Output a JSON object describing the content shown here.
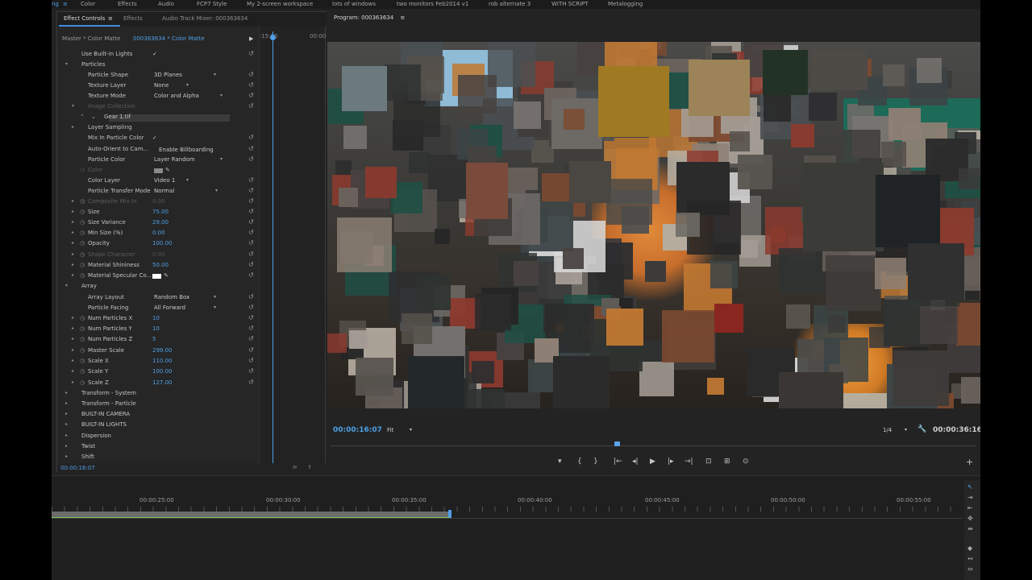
{
  "workspaces": [
    "ng",
    "≡",
    "Color",
    "Effects",
    "Audio",
    "FCP7 Style",
    "My 2-screen workspace",
    "lots of windows",
    "two monitors Feb2014 v1",
    "rob alternate 3",
    "WITH SCRIPT",
    "Metalogging"
  ],
  "panel_tabs": {
    "effect_controls": "Effect Controls",
    "menu": "≡",
    "effects": "Effects",
    "audio_mixer": "Audio Track Mixer: 000363634"
  },
  "clip": {
    "master": "Master * Color Matte",
    "sequence_clip": "000363634 * Color Matte",
    "play": "▶",
    "ruler_start": ":15:00",
    "ruler_end": "00:00"
  },
  "rows": [
    {
      "t": "",
      "s": "",
      "label": "Use Built-in Lights",
      "value": "✓"
    },
    {
      "t": "▾",
      "s": "",
      "label": "Particles",
      "value": ""
    },
    {
      "t": "",
      "s": "",
      "label": "Particle Shape",
      "value": "3D Planes",
      "dd": "▾"
    },
    {
      "t": "",
      "s": "",
      "label": "Texture Layer",
      "value": "None",
      "dd": "▾"
    },
    {
      "t": "",
      "s": "",
      "label": "Texture Mode",
      "value": "Color and Alpha",
      "dd": "▾"
    },
    {
      "t": "▾",
      "s": "",
      "label": "Image Collection",
      "value": ""
    },
    {
      "t": "",
      "s": "",
      "label": "Gear 1.tif",
      "value": ""
    },
    {
      "t": "▸",
      "s": "",
      "label": "Layer Sampling",
      "value": ""
    },
    {
      "t": "",
      "s": "",
      "label": "Mix In Particle Color",
      "value": "✓"
    },
    {
      "t": "",
      "s": "",
      "label": "Auto-Orient to Cam...",
      "value": "Enable Billboarding"
    },
    {
      "t": "",
      "s": "",
      "label": "Particle Color",
      "value": "Layer Random",
      "dd": "▾"
    },
    {
      "t": "",
      "s": "◷",
      "label": "Color",
      "value": ""
    },
    {
      "t": "",
      "s": "",
      "label": "Color Layer",
      "value": "Video 1",
      "dd": "▾"
    },
    {
      "t": "",
      "s": "",
      "label": "Particle Transfer Mode",
      "value": "Normal",
      "dd": "▾"
    },
    {
      "t": "▸",
      "s": "◷",
      "label": "Composite Mix In",
      "value": "0.00"
    },
    {
      "t": "▸",
      "s": "◷",
      "label": "Size",
      "value": "75.00"
    },
    {
      "t": "▸",
      "s": "◷",
      "label": "Size Variance",
      "value": "29.00"
    },
    {
      "t": "▸",
      "s": "◷",
      "label": "Min Size (%)",
      "value": "0.00"
    },
    {
      "t": "▸",
      "s": "◷",
      "label": "Opacity",
      "value": "100.00"
    },
    {
      "t": "▸",
      "s": "◷",
      "label": "Shape Character",
      "value": "0.00"
    },
    {
      "t": "▸",
      "s": "◷",
      "label": "Material Shininess",
      "value": "50.00"
    },
    {
      "t": "▸",
      "s": "◷",
      "label": "Material Specular Co...",
      "value": ""
    },
    {
      "t": "▾",
      "s": "",
      "label": "Array",
      "value": ""
    },
    {
      "t": "",
      "s": "",
      "label": "Array Layout",
      "value": "Random Box",
      "dd": "▾"
    },
    {
      "t": "",
      "s": "",
      "label": "Particle Facing",
      "value": "All Forward",
      "dd": "▾"
    },
    {
      "t": "▸",
      "s": "◷",
      "label": "Num Particles X",
      "value": "10"
    },
    {
      "t": "▸",
      "s": "◷",
      "label": "Num Particles Y",
      "value": "10"
    },
    {
      "t": "▸",
      "s": "◷",
      "label": "Num Particles Z",
      "value": "5"
    },
    {
      "t": "▸",
      "s": "◷",
      "label": "Master Scale",
      "value": "299.00"
    },
    {
      "t": "▸",
      "s": "◷",
      "label": "Scale X",
      "value": "110.00"
    },
    {
      "t": "▸",
      "s": "◷",
      "label": "Scale Y",
      "value": "100.00"
    },
    {
      "t": "▸",
      "s": "◷",
      "label": "Scale Z",
      "value": "127.00"
    },
    {
      "t": "▸",
      "s": "",
      "label": "Transform - System",
      "value": ""
    },
    {
      "t": "▸",
      "s": "",
      "label": "Transform - Particle",
      "value": ""
    },
    {
      "t": "▸",
      "s": "",
      "label": "BUILT-IN CAMERA",
      "value": ""
    },
    {
      "t": "▸",
      "s": "",
      "label": "BUILT-IN LIGHTS",
      "value": ""
    },
    {
      "t": "▸",
      "s": "",
      "label": "Dispersion",
      "value": ""
    },
    {
      "t": "▸",
      "s": "",
      "label": "Twist",
      "value": ""
    },
    {
      "t": "▸",
      "s": "",
      "label": "Shift",
      "value": ""
    }
  ],
  "ec_footer": {
    "timecode": "00:00:16:07"
  },
  "program": {
    "title": "Program: 000363634",
    "menu": "≡",
    "timecode": "00:00:16:07",
    "fit": "Fit",
    "fit_caret": "▾",
    "resolution": "1/4",
    "res_caret": "▾",
    "settings": "🔧",
    "duration": "00:00:36:16",
    "playhead_fraction": 0.44
  },
  "transport": [
    "▾",
    "{",
    "}",
    "|←",
    "◂|",
    "▶",
    "|▸",
    "→|",
    "⊡",
    "⊞",
    "⊙"
  ],
  "add_button": "+",
  "sequence": {
    "ticks": [
      "00:00:25:00",
      "00:00:30:00",
      "00:00:35:00",
      "00:00:40:00",
      "00:00:45:00",
      "00:00:50:00",
      "00:00:55:00"
    ]
  },
  "tools": [
    "↖",
    "⇥",
    "⇤",
    "✥",
    "⇹",
    "◆",
    "↔",
    "⇔"
  ],
  "colors": {
    "accent": "#4e9fe6",
    "work_area": "#6c6c6c",
    "work_green": "#7ec65b",
    "white_swatch": "#ffffff",
    "gray_swatch": "#8a8a8a"
  }
}
